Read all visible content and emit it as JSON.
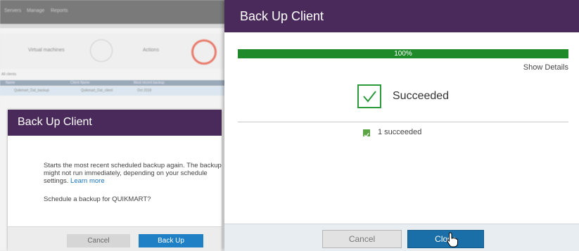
{
  "background": {
    "topbar_items": [
      "Servers",
      "Manage",
      "Reports"
    ],
    "toolbar_left": "Virtual machines",
    "toolbar_right": "Actions",
    "table_headers": [
      "Name",
      "Client Name",
      "Most recent backup",
      "Status"
    ],
    "table_row": [
      "Quikmart_Dat_backup",
      "Quikmart_Dat_client",
      "Oct 2018"
    ],
    "filter_text": "All clients"
  },
  "left_dialog": {
    "title": "Back Up Client",
    "body_text": "Starts the most recent scheduled backup again. The backup might not run immediately, depending on your schedule settings.",
    "learn_more": "Learn more",
    "question": "Schedule a backup for QUIKMART?",
    "cancel_label": "Cancel",
    "backup_label": "Back Up"
  },
  "right_dialog": {
    "title": "Back Up Client",
    "progress_label": "100%",
    "progress_value": 100,
    "show_details": "Show Details",
    "status_text": "Succeeded",
    "count_text": "1 succeeded",
    "cancel_label": "Cancel",
    "close_label": "Close"
  },
  "colors": {
    "title_bar": "#4a2a5a",
    "progress_fill": "#1e8a2a",
    "primary_button": "#1f80c5",
    "success": "#2a9a3a"
  },
  "icons": [
    "check-icon",
    "mini-check-icon",
    "hand-cursor-icon"
  ]
}
